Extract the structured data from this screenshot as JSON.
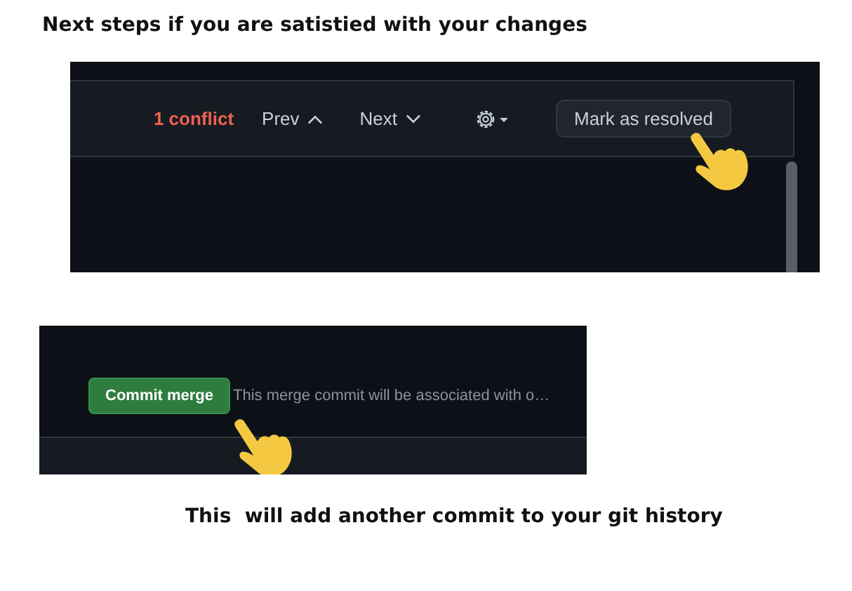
{
  "heading": "Next steps if you are satistied with your changes",
  "conflict_toolbar": {
    "conflict_count": "1 conflict",
    "prev": "Prev",
    "next": "Next",
    "resolve_button": "Mark as resolved"
  },
  "commit_panel": {
    "button": "Commit merge",
    "note": "This merge commit will be associated with o…"
  },
  "caption": "This  will add another commit to your git history"
}
